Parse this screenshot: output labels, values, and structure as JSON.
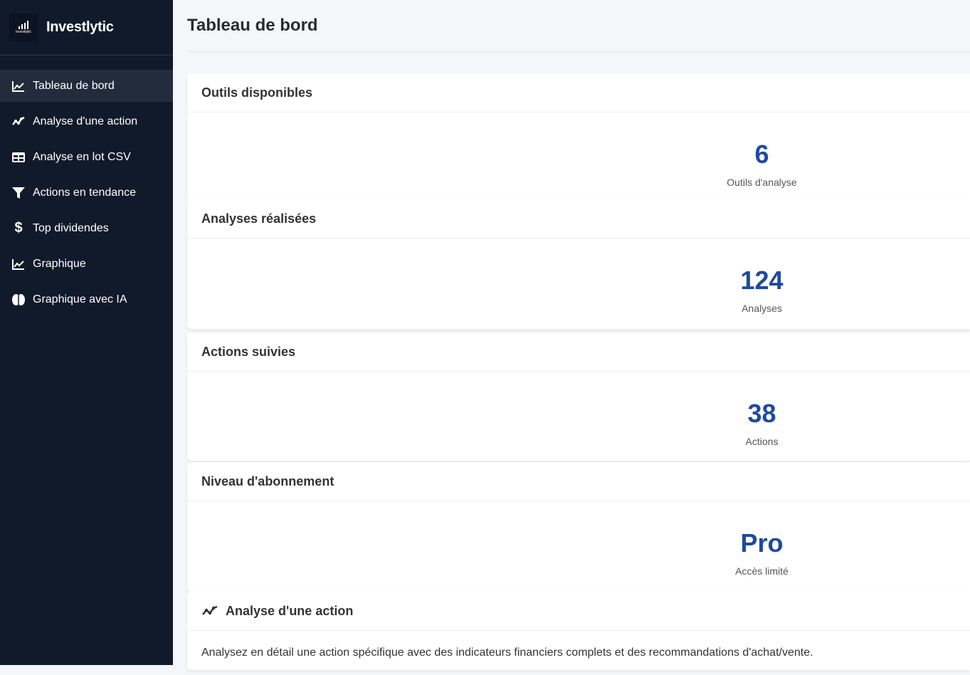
{
  "brand": {
    "name": "Investlytic",
    "logo_text": "Investlytic"
  },
  "sidebar": {
    "items": [
      {
        "label": "Tableau de bord",
        "icon": "line-chart-icon",
        "active": true
      },
      {
        "label": "Analyse d'une action",
        "icon": "trend-icon"
      },
      {
        "label": "Analyse en lot CSV",
        "icon": "table-icon"
      },
      {
        "label": "Actions en tendance",
        "icon": "filter-icon"
      },
      {
        "label": "Top dividendes",
        "icon": "dollar-icon"
      },
      {
        "label": "Graphique",
        "icon": "line-chart-icon"
      },
      {
        "label": "Graphique avec IA",
        "icon": "brain-icon"
      }
    ]
  },
  "header": {
    "title": "Tableau de bord"
  },
  "cards": [
    {
      "title": "Outils disponibles",
      "value": "6",
      "label": "Outils d'analyse"
    },
    {
      "title": "Analyses réalisées",
      "value": "124",
      "label": "Analyses"
    },
    {
      "title": "Actions suivies",
      "value": "38",
      "label": "Actions"
    },
    {
      "title": "Niveau d'abonnement",
      "value": "Pro",
      "label": "Accès limité"
    }
  ],
  "feature_card": {
    "title": "Analyse d'une action",
    "icon": "trend-icon",
    "description": "Analysez en détail une action spécifique avec des indicateurs financiers complets et des recommandations d'achat/vente."
  },
  "colors": {
    "sidebar_bg": "#111a2b",
    "accent": "#1d4aa0",
    "active_bg": "#232c3d"
  }
}
